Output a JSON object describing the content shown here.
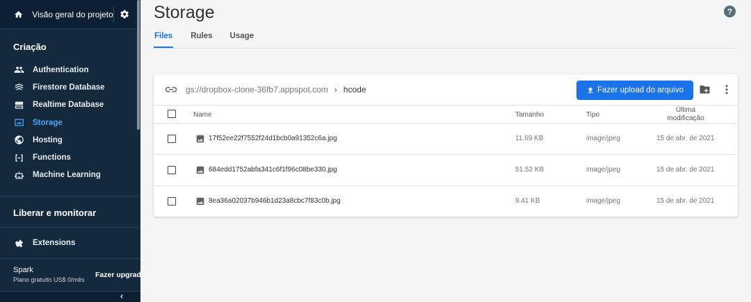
{
  "sidebar": {
    "project_title": "Visão geral do projeto",
    "section_criacao": "Criação",
    "items": [
      {
        "label": "Authentication",
        "icon": "people-icon"
      },
      {
        "label": "Firestore Database",
        "icon": "firestore-icon"
      },
      {
        "label": "Realtime Database",
        "icon": "database-icon"
      },
      {
        "label": "Storage",
        "icon": "storage-icon"
      },
      {
        "label": "Hosting",
        "icon": "globe-icon"
      },
      {
        "label": "Functions",
        "icon": "functions-icon"
      },
      {
        "label": "Machine Learning",
        "icon": "robot-icon"
      }
    ],
    "section_liberar": "Liberar e monitorar",
    "extensions_label": "Extensions",
    "plan_name": "Spark",
    "plan_desc": "Plano gratuito US$ 0/mês",
    "upgrade_label": "Fazer upgrade"
  },
  "main": {
    "title": "Storage",
    "help": "?",
    "tabs": [
      "Files",
      "Rules",
      "Usage"
    ],
    "active_tab": "Files",
    "bucket_path": "gs://dropbox-clone-36fb7.appspot.com",
    "folder": "hcode",
    "upload_label": "Fazer upload do arquivo",
    "columns": {
      "name": "Name",
      "size": "Tamanho",
      "type": "Tipo",
      "modified_line1": "Última",
      "modified_line2": "modificação"
    },
    "files": [
      {
        "name": "17f52ee22f7552f24d1bcb0a91352c6a.jpg",
        "size": "11.69 KB",
        "type": "image/jpeg",
        "modified": "15 de abr. de 2021"
      },
      {
        "name": "684edd1752abfa341c6f1f96c08be330.jpg",
        "size": "51.52 KB",
        "type": "image/jpeg",
        "modified": "15 de abr. de 2021"
      },
      {
        "name": "8ea36a02037b946b1d23a8cbc7f83c0b.jpg",
        "size": "9.41 KB",
        "type": "image/jpeg",
        "modified": "15 de abr. de 2021"
      }
    ]
  },
  "colors": {
    "sidebar_bg": "#15293d",
    "accent": "#1a73e8",
    "active_nav": "#4fa3f7"
  }
}
